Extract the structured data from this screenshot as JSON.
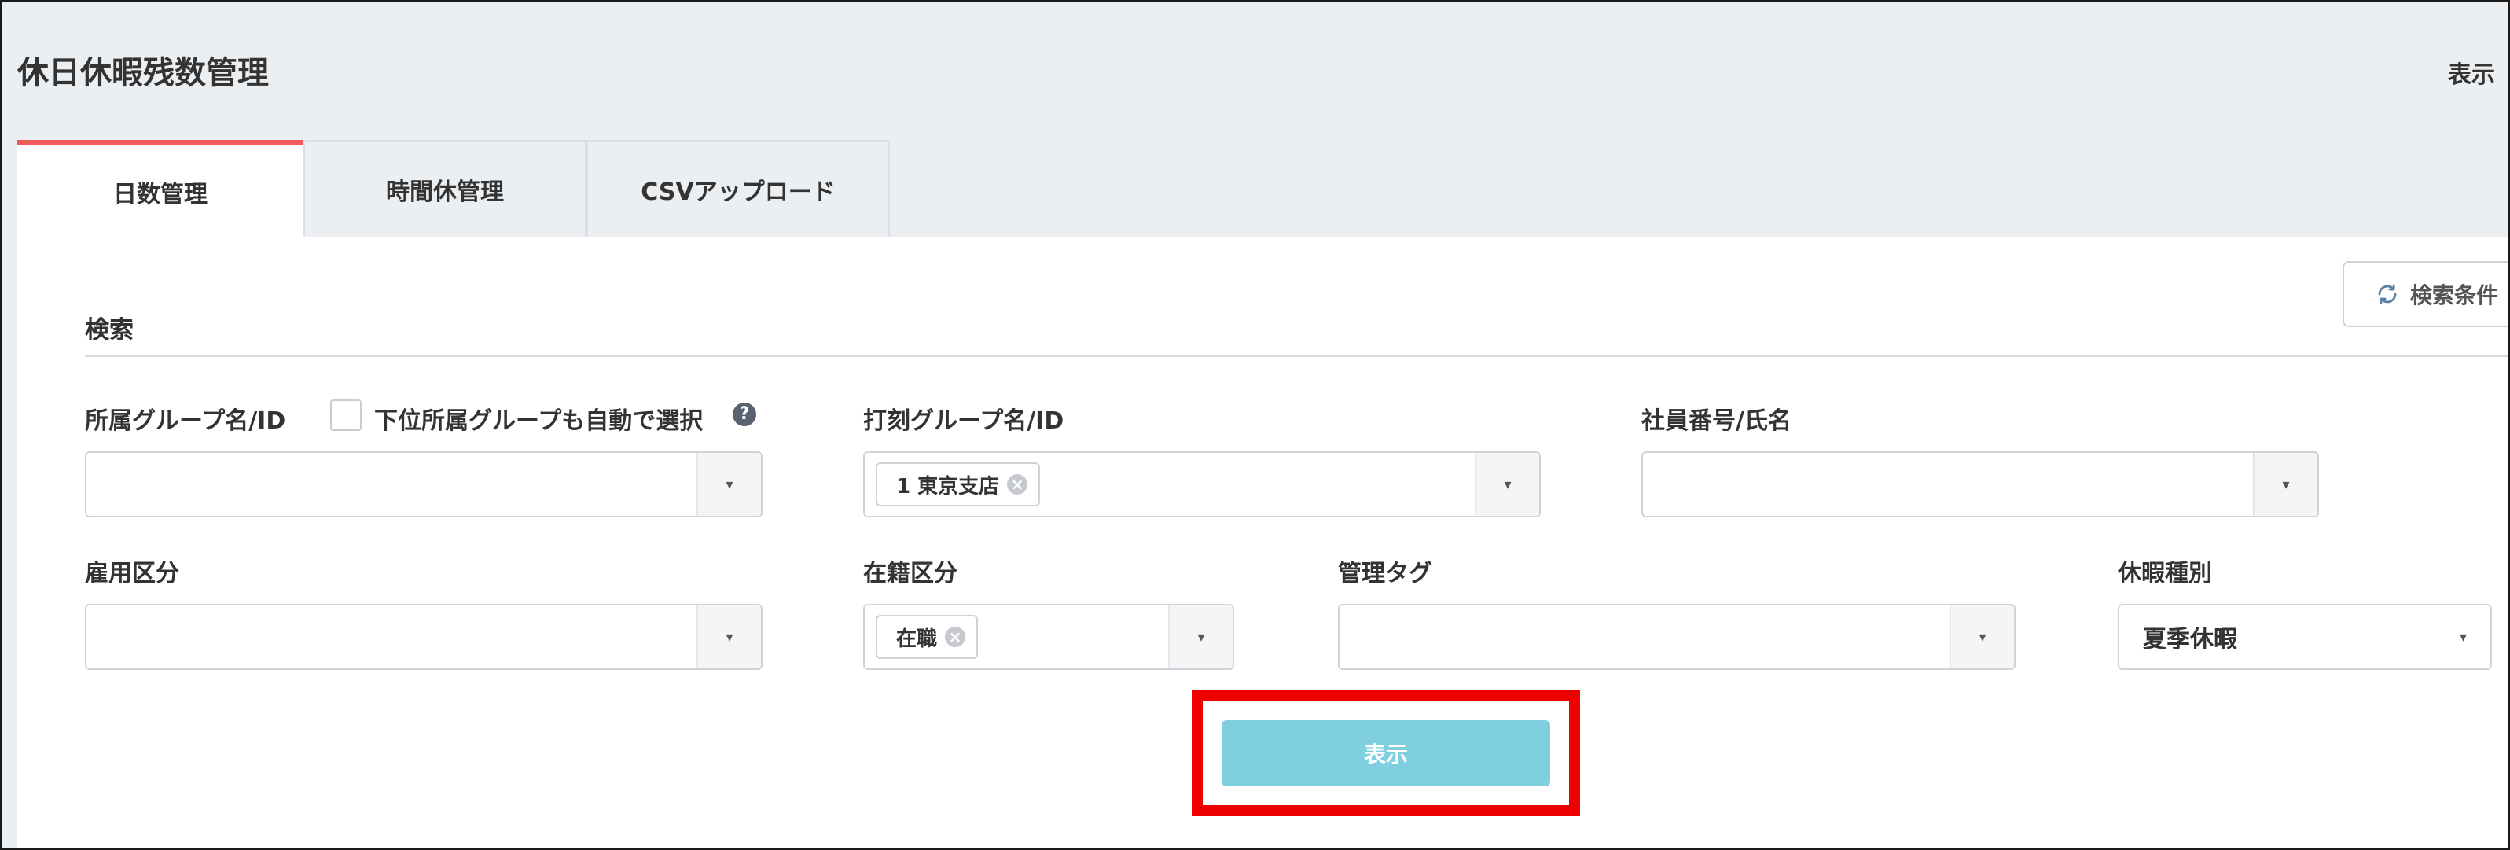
{
  "page_title": "休日休暇残数管理",
  "top_right_label": "表示",
  "tabs": [
    {
      "label": "日数管理",
      "active": true
    },
    {
      "label": "時間休管理",
      "active": false
    },
    {
      "label": "CSVアップロード",
      "active": false
    }
  ],
  "reset_button_label": "検索条件",
  "section_title": "検索",
  "fields": {
    "affiliation_group": {
      "label": "所属グループ名/ID",
      "value": ""
    },
    "sub_group_checkbox": {
      "label": "下位所属グループも自動で選択",
      "checked": false
    },
    "help_icon_glyph": "?",
    "stamp_group": {
      "label": "打刻グループ名/ID",
      "chip": "1 東京支店"
    },
    "employee": {
      "label": "社員番号/氏名",
      "value": ""
    },
    "employment_type": {
      "label": "雇用区分",
      "value": ""
    },
    "enrollment_status": {
      "label": "在籍区分",
      "chip": "在職"
    },
    "management_tag": {
      "label": "管理タグ",
      "value": ""
    },
    "leave_type": {
      "label": "休暇種別",
      "value": "夏季休暇"
    }
  },
  "chip_remove_glyph": "×",
  "dropdown_arrow_glyph": "▾",
  "show_button_label": "表示",
  "colors": {
    "tab_active_accent": "#ef5b5b",
    "primary_button": "#7fcfe0",
    "highlight": "#ee0000",
    "header_bg": "#eceff2"
  }
}
